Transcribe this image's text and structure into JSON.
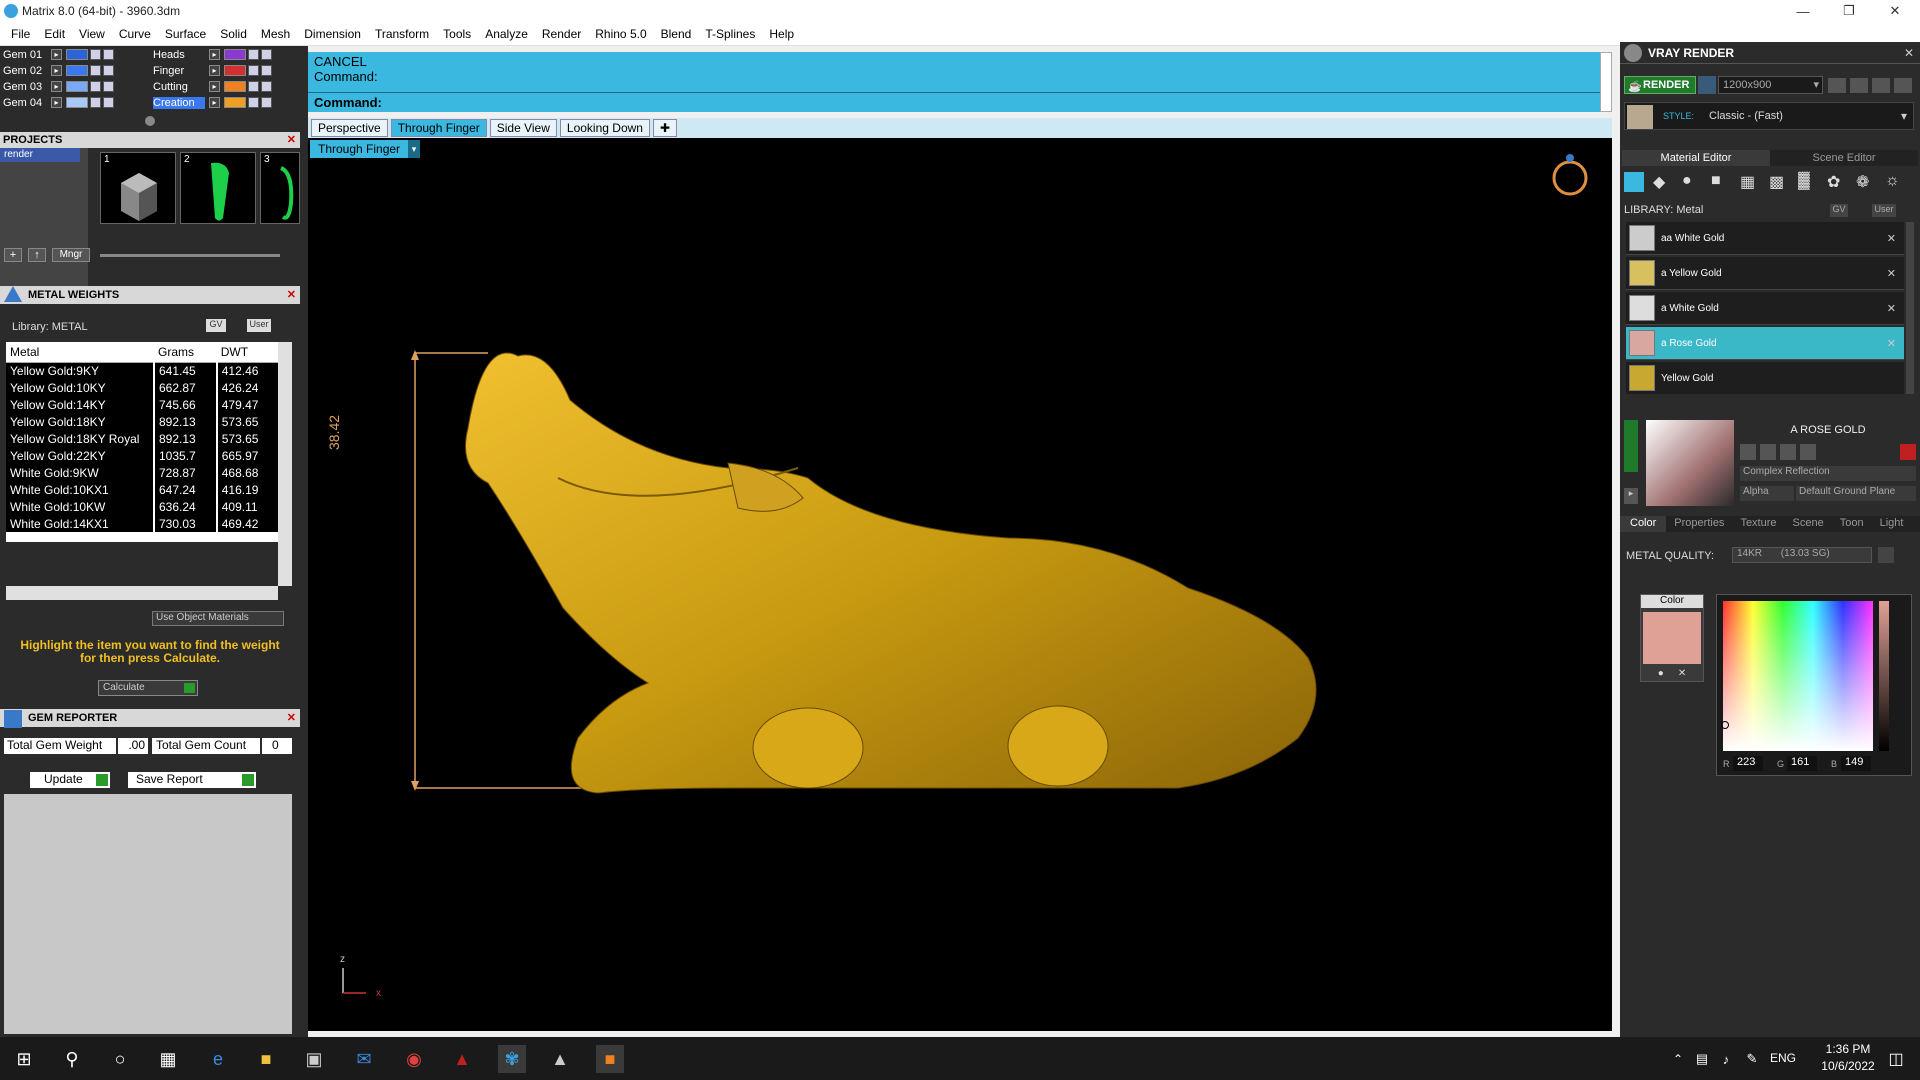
{
  "window": {
    "title": "Matrix 8.0 (64-bit) - 3960.3dm"
  },
  "menu": [
    "File",
    "Edit",
    "View",
    "Curve",
    "Surface",
    "Solid",
    "Mesh",
    "Dimension",
    "Transform",
    "Tools",
    "Analyze",
    "Render",
    "Rhino 5.0",
    "Blend",
    "T-Splines",
    "Help"
  ],
  "layers_left": [
    "Gem 01",
    "Gem 02",
    "Gem 03",
    "Gem 04"
  ],
  "layers_right": [
    "Heads",
    "Finger",
    "Cutting",
    "Creation"
  ],
  "layer_colors_left": [
    "#2a64d8",
    "#3a78f0",
    "#7aa8f8",
    "#a8c8f8"
  ],
  "layer_colors_right": [
    "#8a3ad0",
    "#d03030",
    "#f08020",
    "#f0a020"
  ],
  "projects": {
    "header": "PROJECTS",
    "list_item": "render",
    "thumbs": [
      "1",
      "2",
      "3"
    ],
    "mngr_label": "Mngr"
  },
  "metal_weights": {
    "header": "METAL WEIGHTS",
    "library": "Library: METAL",
    "gv": "GV",
    "user": "User",
    "columns": [
      "Metal",
      "Grams",
      "DWT"
    ],
    "rows": [
      [
        "Yellow Gold:9KY",
        "641.45",
        "412.46"
      ],
      [
        "Yellow Gold:10KY",
        "662.87",
        "426.24"
      ],
      [
        "Yellow Gold:14KY",
        "745.66",
        "479.47"
      ],
      [
        "Yellow Gold:18KY",
        "892.13",
        "573.65"
      ],
      [
        "Yellow Gold:18KY Royal",
        "892.13",
        "573.65"
      ],
      [
        "Yellow Gold:22KY",
        "1035.7",
        "665.97"
      ],
      [
        "White Gold:9KW",
        "728.87",
        "468.68"
      ],
      [
        "White Gold:10KX1",
        "647.24",
        "416.19"
      ],
      [
        "White Gold:10KW",
        "636.24",
        "409.11"
      ],
      [
        "White Gold:14KX1",
        "730.03",
        "469.42"
      ]
    ],
    "use_object_materials": "Use Object Materials",
    "hint": "Highlight the item you want to find the weight for then press Calculate.",
    "calculate": "Calculate"
  },
  "gem_reporter": {
    "header": "GEM REPORTER",
    "total_weight_label": "Total Gem Weight",
    "total_weight_value": ".00",
    "total_count_label": "Total Gem Count",
    "total_count_value": "0",
    "update": "Update",
    "save_report": "Save Report"
  },
  "command": {
    "cancel": "CANCEL",
    "line1": "Command:",
    "line2": "Command:"
  },
  "viewport_tabs": [
    "Perspective",
    "Through Finger",
    "Side View",
    "Looking Down"
  ],
  "viewport_active": "Through Finger",
  "dimension_label": "38.42",
  "axis": {
    "z": "z",
    "x": "x"
  },
  "vray": {
    "title": "VRAY RENDER",
    "render_button": "RENDER",
    "resolution": "1200x900",
    "style_label": "STYLE:",
    "style_value": "Classic - (Fast)",
    "tabs": [
      "Material Editor",
      "Scene Editor"
    ],
    "library": "LIBRARY: Metal",
    "gv": "GV",
    "user": "User",
    "materials": [
      "aa White Gold",
      "a Yellow Gold",
      "a White Gold",
      "a Rose Gold",
      "Yellow Gold"
    ],
    "selected_material": "a Rose Gold",
    "material_title": "A ROSE GOLD",
    "reflection": "Complex Reflection",
    "alpha": "Alpha",
    "ground": "Default Ground Plane",
    "sub_tabs": [
      "Color",
      "Properties",
      "Texture",
      "Scene",
      "Toon",
      "Light"
    ],
    "metal_quality_label": "METAL QUALITY:",
    "metal_quality_value": "14KR",
    "metal_quality_sg": "(13.03 SG)",
    "color_label": "Color",
    "swatch_color": "#df a195",
    "rgb": {
      "R_label": "R",
      "R": "223",
      "G_label": "G",
      "G": "161",
      "B_label": "B",
      "B": "149"
    }
  },
  "taskbar": {
    "lang": "ENG",
    "time": "1:36 PM",
    "date": "10/6/2022"
  }
}
